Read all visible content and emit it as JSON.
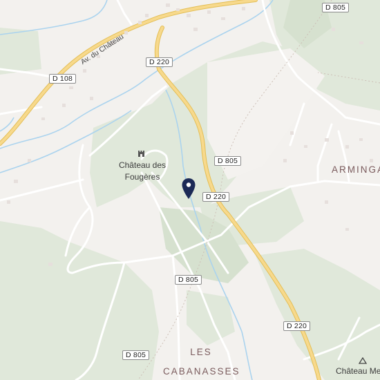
{
  "roads": {
    "d805_a": "D 805",
    "d805_b": "D 805",
    "d805_c": "D 805",
    "d805_top": "D 805",
    "d220_a": "D 220",
    "d220_b": "D 220",
    "d220_c": "D 220",
    "d108": "D 108"
  },
  "streets": {
    "av_chateau": "Av. du Château"
  },
  "places": {
    "armingal": "ARMINGA",
    "cabanasses": "LES CABANASSES"
  },
  "pois": {
    "chateau_fougeres_line1": "Château des",
    "chateau_fougeres_line2": "Fougères",
    "chateau_me": "Château Me"
  },
  "icons": {
    "pin": "location-pin-icon",
    "castle": "castle-icon",
    "monument": "monument-icon"
  },
  "colors": {
    "land": "#f3f1ee",
    "green": "#dfe7da",
    "green_dark": "#d3dfcc",
    "major_road": "#f3d27a",
    "major_road_edge": "#e0b94d",
    "water": "#aad3ee",
    "pin": "#1c2a56",
    "place_label": "#7a5a5c"
  }
}
